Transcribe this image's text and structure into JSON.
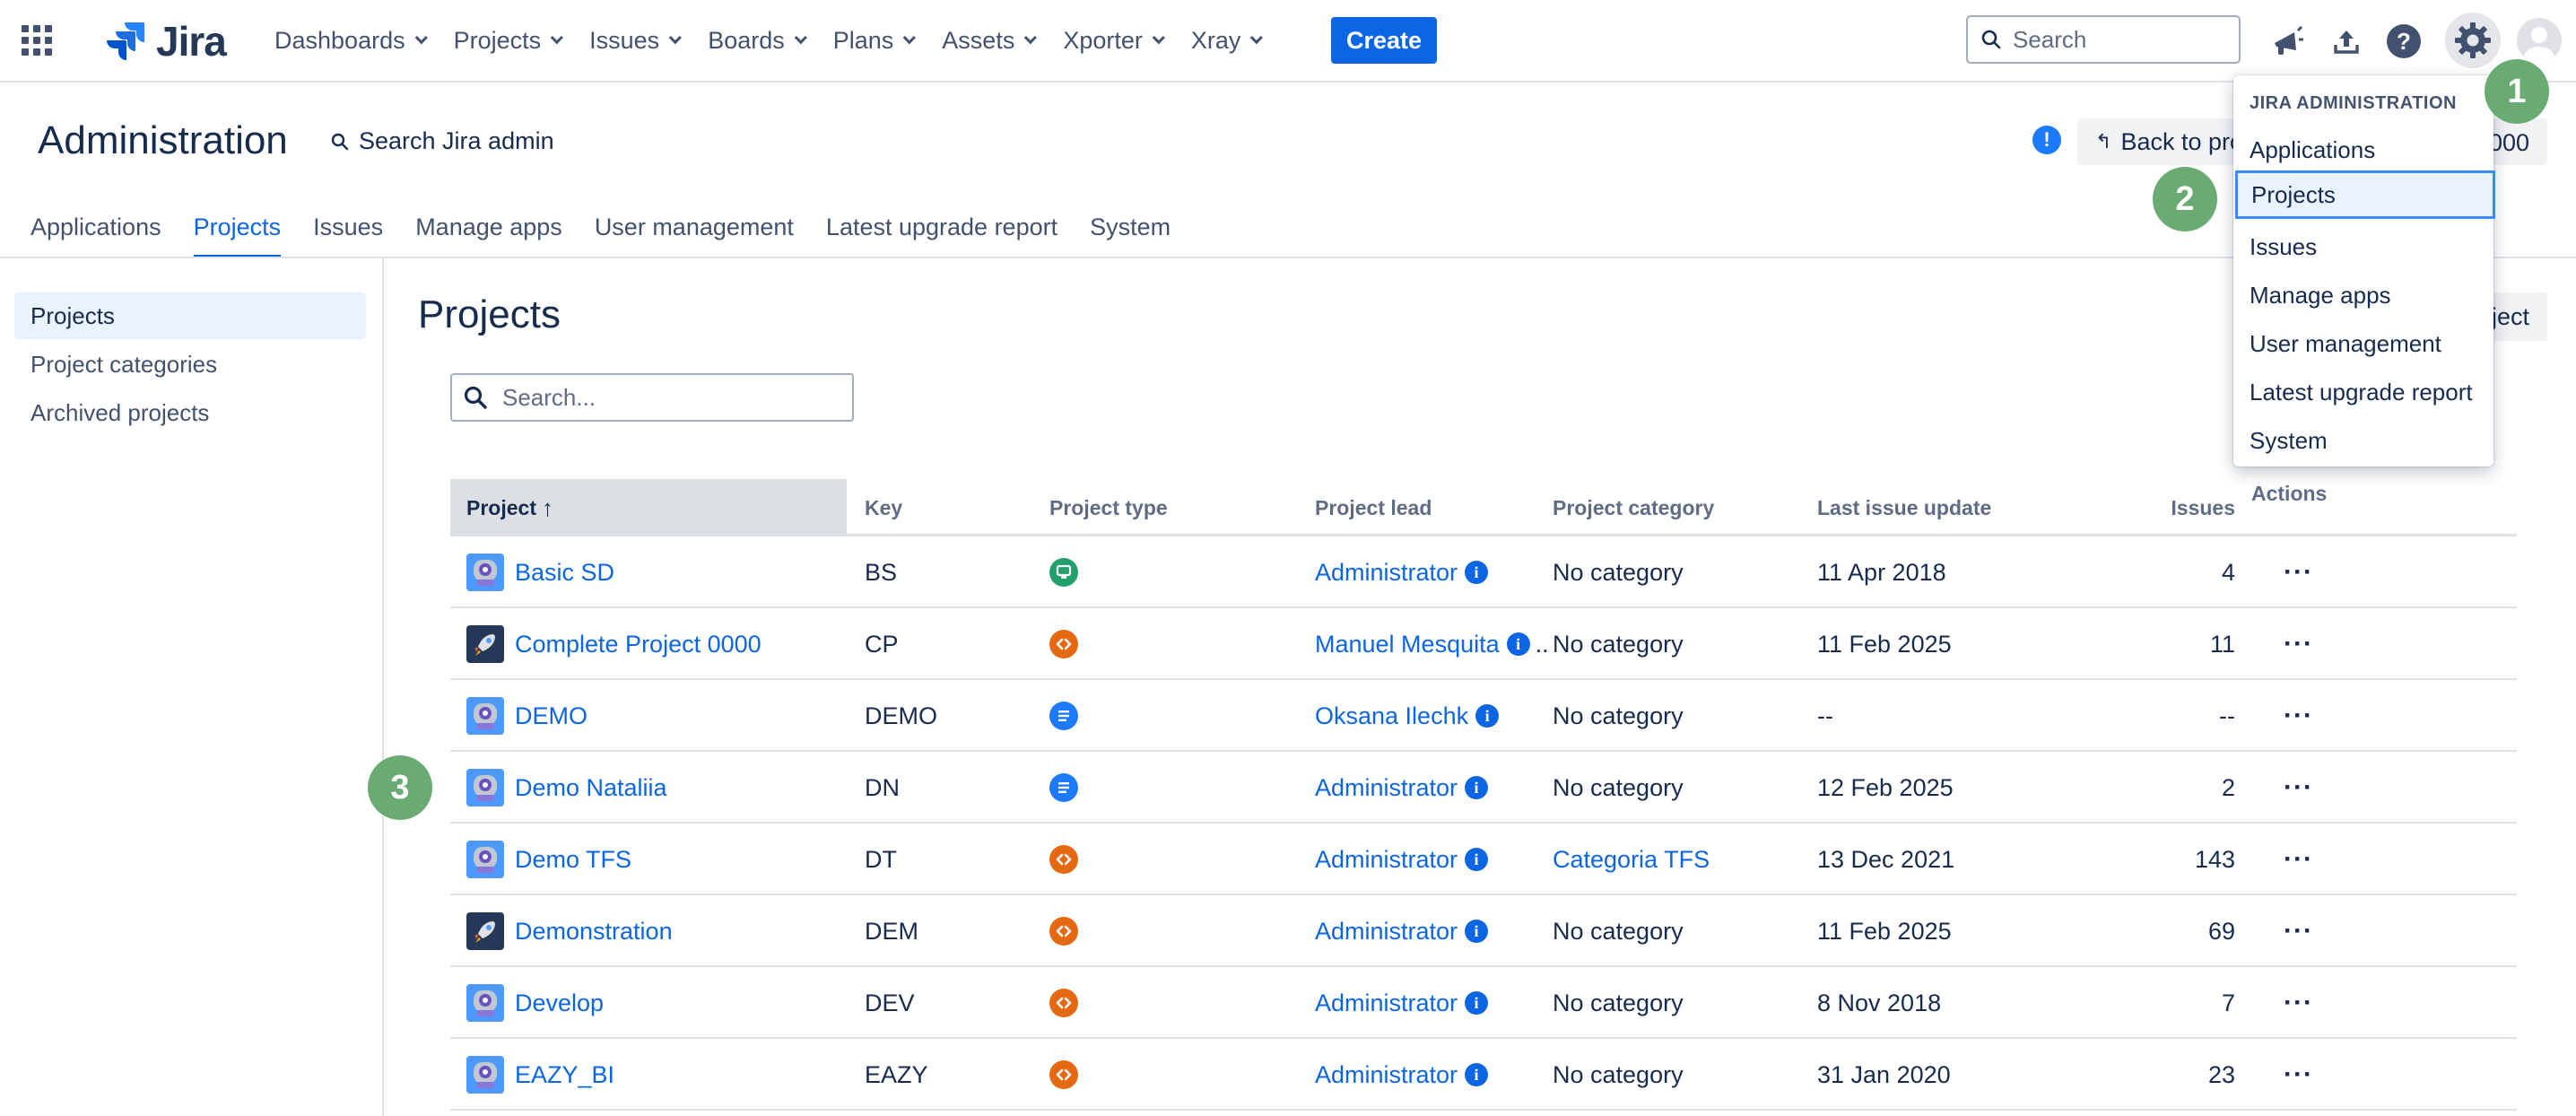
{
  "topnav": {
    "logo_text": "Jira",
    "menu": [
      "Dashboards",
      "Projects",
      "Issues",
      "Boards",
      "Plans",
      "Assets",
      "Xporter",
      "Xray"
    ],
    "create_label": "Create",
    "search_placeholder": "Search",
    "icons": [
      "app-switcher-icon",
      "megaphone-icon",
      "upload-icon",
      "help-icon",
      "gear-icon",
      "avatar"
    ]
  },
  "admin": {
    "title": "Administration",
    "search_label": "Search Jira admin",
    "back_label": "Back to pro",
    "back_tail": "000",
    "tabs": [
      "Applications",
      "Projects",
      "Issues",
      "Manage apps",
      "User management",
      "Latest upgrade report",
      "System"
    ],
    "active_tab": "Projects"
  },
  "sidebar": {
    "items": [
      "Projects",
      "Project categories",
      "Archived projects"
    ],
    "active": "Projects"
  },
  "main": {
    "title": "Projects",
    "create_button_visible": "ject",
    "search_placeholder": "Search...",
    "columns": {
      "project": "Project",
      "key": "Key",
      "type": "Project type",
      "lead": "Project lead",
      "category": "Project category",
      "last_update": "Last issue update",
      "issues": "Issues",
      "actions": "Actions"
    },
    "rows": [
      {
        "name": "Basic SD",
        "avatar": "robot",
        "key": "BS",
        "type": "service-desk",
        "lead": "Administrator",
        "lead_extra": "",
        "category": "No category",
        "category_link": false,
        "last_update": "11 Apr 2018",
        "issues": "4"
      },
      {
        "name": "Complete Project 0000",
        "avatar": "rocket",
        "key": "CP",
        "type": "software",
        "lead": "Manuel Mesquita",
        "lead_extra": "..",
        "category": "No category",
        "category_link": false,
        "last_update": "11 Feb 2025",
        "issues": "11"
      },
      {
        "name": "DEMO",
        "avatar": "robot",
        "key": "DEMO",
        "type": "business",
        "lead": "Oksana Ilechk",
        "lead_extra": "",
        "category": "No category",
        "category_link": false,
        "last_update": "--",
        "issues": "--"
      },
      {
        "name": "Demo Nataliia",
        "avatar": "robot",
        "key": "DN",
        "type": "business",
        "lead": "Administrator",
        "lead_extra": "",
        "category": "No category",
        "category_link": false,
        "last_update": "12 Feb 2025",
        "issues": "2"
      },
      {
        "name": "Demo TFS",
        "avatar": "robot",
        "key": "DT",
        "type": "software",
        "lead": "Administrator",
        "lead_extra": "",
        "category": "Categoria TFS",
        "category_link": true,
        "last_update": "13 Dec 2021",
        "issues": "143"
      },
      {
        "name": "Demonstration",
        "avatar": "rocket",
        "key": "DEM",
        "type": "software",
        "lead": "Administrator",
        "lead_extra": "",
        "category": "No category",
        "category_link": false,
        "last_update": "11 Feb 2025",
        "issues": "69"
      },
      {
        "name": "Develop",
        "avatar": "robot",
        "key": "DEV",
        "type": "software",
        "lead": "Administrator",
        "lead_extra": "",
        "category": "No category",
        "category_link": false,
        "last_update": "8 Nov 2018",
        "issues": "7"
      },
      {
        "name": "EAZY_BI",
        "avatar": "robot",
        "key": "EAZY",
        "type": "software",
        "lead": "Administrator",
        "lead_extra": "",
        "category": "No category",
        "category_link": false,
        "last_update": "31 Jan 2020",
        "issues": "23"
      }
    ],
    "actions_glyph": "···"
  },
  "dropdown": {
    "heading": "JIRA ADMINISTRATION",
    "items": [
      "Applications",
      "Projects",
      "Issues",
      "Manage apps",
      "User management",
      "Latest upgrade report",
      "System"
    ],
    "focused": "Projects"
  },
  "steps": [
    "1",
    "2",
    "3"
  ],
  "colors": {
    "brand_blue": "#0c66e4",
    "step_green": "#6aab73",
    "service_desk_green": "#22a06b",
    "software_orange": "#e56910",
    "business_blue": "#1d7afc"
  }
}
